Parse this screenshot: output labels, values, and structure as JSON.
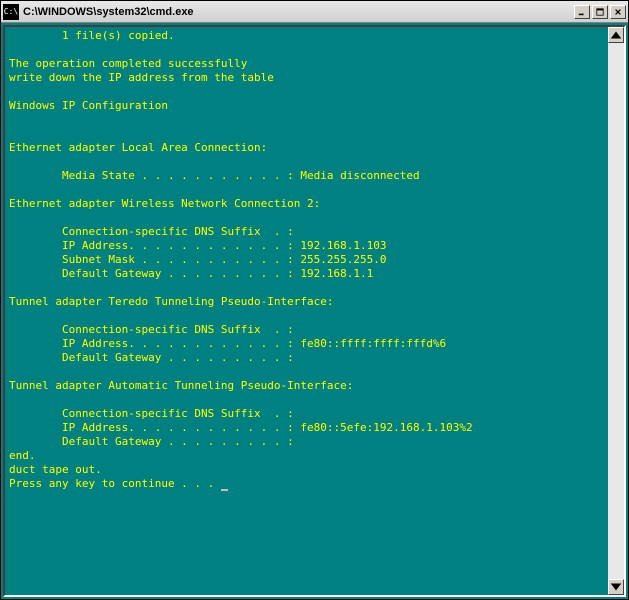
{
  "window": {
    "title": "C:\\WINDOWS\\system32\\cmd.exe",
    "icon_text": "C:\\"
  },
  "console": {
    "lines": [
      "        1 file(s) copied.",
      "",
      "The operation completed successfully",
      "write down the IP address from the table",
      "",
      "Windows IP Configuration",
      "",
      "",
      "Ethernet adapter Local Area Connection:",
      "",
      "        Media State . . . . . . . . . . . : Media disconnected",
      "",
      "Ethernet adapter Wireless Network Connection 2:",
      "",
      "        Connection-specific DNS Suffix  . :",
      "        IP Address. . . . . . . . . . . . : 192.168.1.103",
      "        Subnet Mask . . . . . . . . . . . : 255.255.255.0",
      "        Default Gateway . . . . . . . . . : 192.168.1.1",
      "",
      "Tunnel adapter Teredo Tunneling Pseudo-Interface:",
      "",
      "        Connection-specific DNS Suffix  . :",
      "        IP Address. . . . . . . . . . . . : fe80::ffff:ffff:fffd%6",
      "        Default Gateway . . . . . . . . . :",
      "",
      "Tunnel adapter Automatic Tunneling Pseudo-Interface:",
      "",
      "        Connection-specific DNS Suffix  . :",
      "        IP Address. . . . . . . . . . . . : fe80::5efe:192.168.1.103%2",
      "        Default Gateway . . . . . . . . . :",
      "end.",
      "duct tape out.",
      "Press any key to continue . . . "
    ]
  },
  "ipconfig": {
    "copy_result": "1 file(s) copied.",
    "operation_status": "The operation completed successfully",
    "instruction": "write down the IP address from the table",
    "header": "Windows IP Configuration",
    "adapters": [
      {
        "name": "Ethernet adapter Local Area Connection",
        "media_state": "Media disconnected"
      },
      {
        "name": "Ethernet adapter Wireless Network Connection 2",
        "dns_suffix": "",
        "ip_address": "192.168.1.103",
        "subnet_mask": "255.255.255.0",
        "default_gateway": "192.168.1.1"
      },
      {
        "name": "Tunnel adapter Teredo Tunneling Pseudo-Interface",
        "dns_suffix": "",
        "ip_address": "fe80::ffff:ffff:fffd%6",
        "default_gateway": ""
      },
      {
        "name": "Tunnel adapter Automatic Tunneling Pseudo-Interface",
        "dns_suffix": "",
        "ip_address": "fe80::5efe:192.168.1.103%2",
        "default_gateway": ""
      }
    ],
    "footer": [
      "end.",
      "duct tape out."
    ],
    "prompt": "Press any key to continue . . . "
  }
}
